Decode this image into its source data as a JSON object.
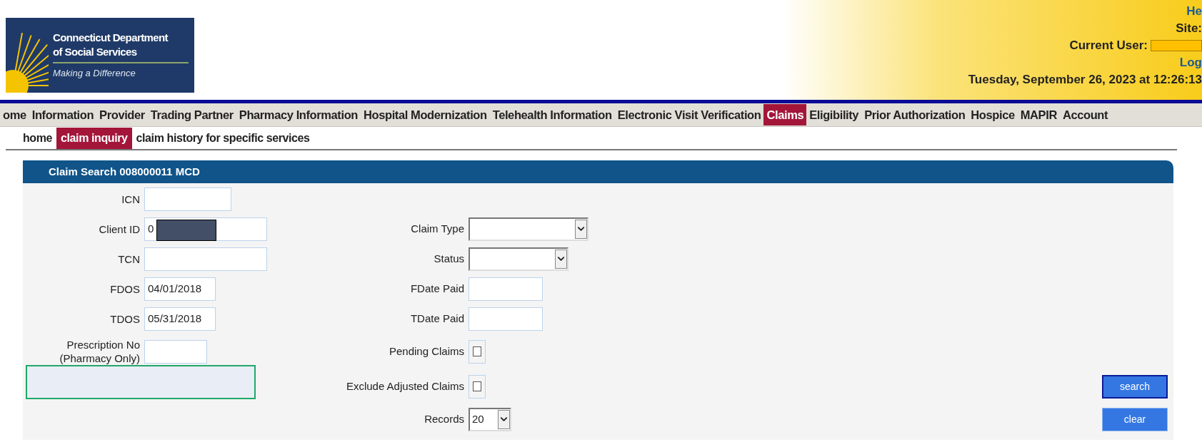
{
  "logo": {
    "line1": "Connecticut Department",
    "line2": "of Social Services",
    "tagline": "Making a Difference"
  },
  "user_area": {
    "help_link": "He",
    "site_label": "Site:",
    "current_user_label": "Current User:",
    "logout_link": "Log",
    "datetime": "Tuesday, September 26, 2023 at 12:26:13"
  },
  "nav": [
    {
      "label": "ome",
      "selected": false
    },
    {
      "label": "Information",
      "selected": false
    },
    {
      "label": "Provider",
      "selected": false
    },
    {
      "label": "Trading Partner",
      "selected": false
    },
    {
      "label": "Pharmacy Information",
      "selected": false
    },
    {
      "label": "Hospital Modernization",
      "selected": false
    },
    {
      "label": "Telehealth Information",
      "selected": false
    },
    {
      "label": "Electronic Visit Verification",
      "selected": false
    },
    {
      "label": "Claims",
      "selected": true
    },
    {
      "label": "Eligibility",
      "selected": false
    },
    {
      "label": "Prior Authorization",
      "selected": false
    },
    {
      "label": "Hospice",
      "selected": false
    },
    {
      "label": "MAPIR",
      "selected": false
    },
    {
      "label": "Account",
      "selected": false
    }
  ],
  "subnav": [
    {
      "label": "home",
      "selected": false
    },
    {
      "label": "claim inquiry",
      "selected": true
    },
    {
      "label": "claim history for specific services",
      "selected": false
    }
  ],
  "panel": {
    "title": "Claim Search 008000011 MCD"
  },
  "left_fields": [
    {
      "label": "ICN",
      "redacted": false
    },
    {
      "label": "Client ID",
      "value": "0",
      "redacted": true
    },
    {
      "label": "TCN",
      "redacted": false
    },
    {
      "label": "FDOS",
      "value": "04/01/2018",
      "redacted": false
    },
    {
      "label": "TDOS",
      "value": "05/31/2018",
      "redacted": false
    },
    {
      "label": "Prescription No (Pharmacy Only)",
      "redacted": false
    }
  ],
  "right_fields": [
    {
      "kind": "select",
      "label": "Claim Type"
    },
    {
      "kind": "select",
      "label": "Status"
    },
    {
      "kind": "text",
      "label": "FDate Paid"
    },
    {
      "kind": "text",
      "label": "TDate Paid"
    },
    {
      "kind": "checkbox",
      "label": "Pending Claims",
      "checked": false
    },
    {
      "kind": "checkbox",
      "label": "Exclude Adjusted Claims",
      "checked": false
    },
    {
      "kind": "select",
      "label": "Records",
      "value": "20"
    }
  ],
  "buttons": [
    {
      "label": "search",
      "focused": true
    },
    {
      "label": "clear",
      "focused": false
    }
  ]
}
